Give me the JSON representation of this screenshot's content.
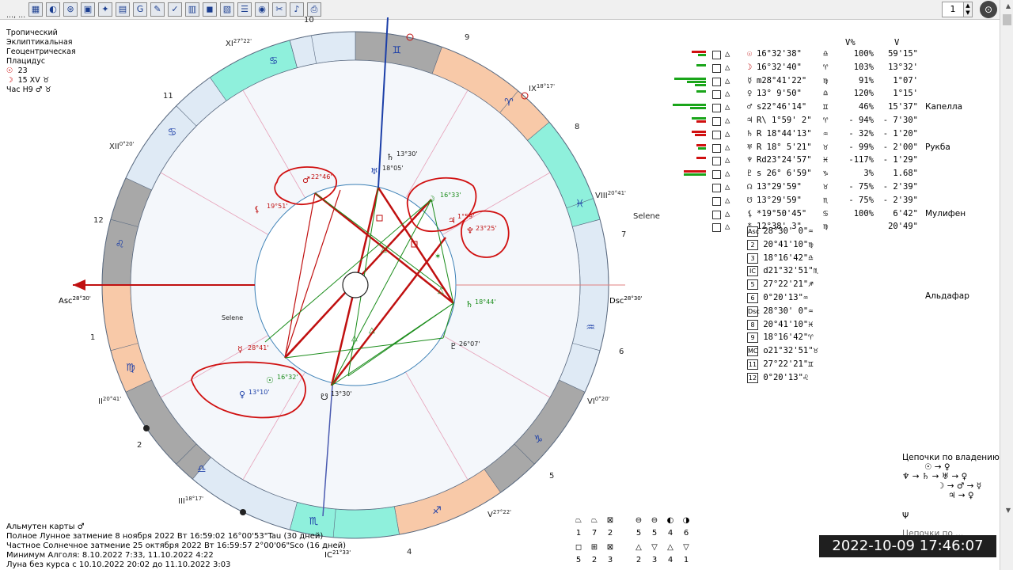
{
  "toolbar": {
    "icons": [
      "table-icon",
      "globe-icon",
      "wheel-icon",
      "map-icon",
      "transit-icon",
      "calendar-icon",
      "g-icon",
      "edit-icon",
      "check-icon",
      "grid-icon",
      "palette-icon",
      "aspect-icon",
      "list-icon",
      "blue-wheel-icon",
      "tools-icon",
      "bell-icon",
      "print-icon"
    ],
    "page_number": "1"
  },
  "header": {
    "clipped_line": "..., ...",
    "zodiac": "Тропический",
    "ecliptic": "Эклиптикальная",
    "centric": "Геоцентрическая",
    "house_system": "Плацидус",
    "sun_day": "23",
    "moon_day": "15 XV",
    "hour": "Час H9"
  },
  "wheel": {
    "asc_label": "Asc",
    "asc_deg": "28°30'",
    "dsc_label": "Dsc",
    "dsc_deg": "28°30'",
    "ic_label": "IC",
    "ic_deg": "21°33'",
    "cusps": [
      {
        "label": "XI",
        "deg": "27°22'"
      },
      {
        "label": "XII",
        "deg": "0°20'"
      },
      {
        "label": "II",
        "deg": "20°41'"
      },
      {
        "label": "III",
        "deg": "18°17'"
      },
      {
        "label": "IX",
        "deg": "18°17'"
      },
      {
        "label": "VIII",
        "deg": "20°41'"
      },
      {
        "label": "VI",
        "deg": "0°20'"
      },
      {
        "label": "V",
        "deg": "27°22'"
      }
    ],
    "house_numbers": [
      "10",
      "9",
      "11",
      "8",
      "12",
      "7",
      "1",
      "6",
      "2",
      "5",
      "4"
    ],
    "planet_labels": {
      "saturn_top": "13°30'",
      "mc_area": "18°05'",
      "p22": "22°46'",
      "lilith": "19°51'",
      "moon": "16°33'",
      "jupiter": "1°59'",
      "neptune": "23°25'",
      "saturn_r": "18°44'",
      "pluto": "26°07'",
      "mars": "28°41'",
      "sun": "16°32'",
      "venus": "13°10'",
      "node": "13°30'",
      "selene": "Selene",
      "selene_outer": "Selene"
    }
  },
  "planets": [
    {
      "sym": "☉",
      "pos": "16°32'38\"",
      "sign": "♎",
      "pct": "100%",
      "speed": "59'15\"",
      "star": "",
      "bars": [
        [
          18,
          "r"
        ],
        [
          10,
          "g"
        ]
      ]
    },
    {
      "sym": "☽",
      "pos": "16°32'40\"",
      "sign": "♈",
      "pct": "103%",
      "speed": "13°32'",
      "star": "",
      "bars": [
        [
          12,
          "g"
        ]
      ]
    },
    {
      "sym": "☿",
      "pos": "m28°41'22\"",
      "sign": "♍",
      "pct": "91%",
      "speed": "1°07'",
      "star": "",
      "bars": [
        [
          40,
          "g"
        ],
        [
          24,
          "g"
        ],
        [
          14,
          "g"
        ]
      ]
    },
    {
      "sym": "♀",
      "pos": "13° 9'50\"",
      "sign": "♎",
      "pct": "120%",
      "speed": "1°15'",
      "star": "",
      "bars": [
        [
          12,
          "g"
        ]
      ]
    },
    {
      "sym": "♂",
      "pos": "s22°46'14\"",
      "sign": "♊",
      "pct": "46%",
      "speed": "15'37\"",
      "star": "Капелла",
      "bars": [
        [
          42,
          "g"
        ],
        [
          20,
          "g"
        ]
      ]
    },
    {
      "sym": "♃",
      "pos": "R\\ 1°59' 2\"",
      "sign": "♈",
      "pct": "- 94%",
      "speed": "- 7'30\"",
      "star": "",
      "bars": [
        [
          18,
          "g"
        ],
        [
          12,
          "r"
        ]
      ]
    },
    {
      "sym": "♄",
      "pos": "R 18°44'13\"",
      "sign": "♒",
      "pct": "- 32%",
      "speed": "- 1'20\"",
      "star": "",
      "bars": [
        [
          18,
          "r"
        ],
        [
          14,
          "r"
        ]
      ]
    },
    {
      "sym": "♅",
      "pos": "R 18° 5'21\"",
      "sign": "♉",
      "pct": "- 99%",
      "speed": "- 2'00\"",
      "star": "Рукба",
      "bars": [
        [
          12,
          "r"
        ],
        [
          10,
          "g"
        ]
      ]
    },
    {
      "sym": "♆",
      "pos": "Rd23°24'57\"",
      "sign": "♓",
      "pct": "-117%",
      "speed": "- 1'29\"",
      "star": "",
      "bars": [
        [
          12,
          "r"
        ]
      ]
    },
    {
      "sym": "♇",
      "pos": "s 26° 6'59\"",
      "sign": "♑",
      "pct": "3%",
      "speed": "1.68\"",
      "star": "",
      "bars": [
        [
          28,
          "r"
        ],
        [
          28,
          "g"
        ]
      ]
    },
    {
      "sym": "☊",
      "pos": "13°29'59\"",
      "sign": "♉",
      "pct": "- 75%",
      "speed": "- 2'39\"",
      "star": "",
      "bars": []
    },
    {
      "sym": "☋",
      "pos": "13°29'59\"",
      "sign": "♏",
      "pct": "- 75%",
      "speed": "- 2'39\"",
      "star": "",
      "bars": []
    },
    {
      "sym": "⚸",
      "pos": "*19°50'45\"",
      "sign": "♋",
      "pct": "100%",
      "speed": "6'42\"",
      "star": "Мулифен",
      "bars": []
    },
    {
      "sym": "*",
      "pos": "12°38' 3\"",
      "sign": "♍",
      "pct": "",
      "speed": "20'49\"",
      "star": "",
      "bars": []
    }
  ],
  "cusps": [
    {
      "lbl": "Asc",
      "pos": "28°30' 0\"",
      "sign": "♒"
    },
    {
      "lbl": "2",
      "pos": "20°41'10\"",
      "sign": "♍"
    },
    {
      "lbl": "3",
      "pos": "18°16'42\"",
      "sign": "♎"
    },
    {
      "lbl": "IC",
      "pos": "d21°32'51\"",
      "sign": "♏"
    },
    {
      "lbl": "5",
      "pos": "27°22'21\"",
      "sign": "♐"
    },
    {
      "lbl": "6",
      "pos": "0°20'13\"",
      "sign": "♒"
    },
    {
      "lbl": "Dsc",
      "pos": "28°30' 0\"",
      "sign": "♒"
    },
    {
      "lbl": "8",
      "pos": "20°41'10\"",
      "sign": "♓"
    },
    {
      "lbl": "9",
      "pos": "18°16'42\"",
      "sign": "♈"
    },
    {
      "lbl": "MC",
      "pos": "o21°32'51\"",
      "sign": "♉"
    },
    {
      "lbl": "11",
      "pos": "27°22'21\"",
      "sign": "♊"
    },
    {
      "lbl": "12",
      "pos": "0°20'13\"",
      "sign": "♌"
    }
  ],
  "stars": {
    "aldafar": "Альдафар"
  },
  "chains": {
    "title": "Цепочки по владению",
    "rows": [
      "☉ → ♀",
      "♆ → ♄ → ♅ → ♀",
      "☽ → ♂ → ☿",
      "♃ → ♀"
    ],
    "tail": "Ψ",
    "clipped": "Цепочки по ...",
    "clipped_bottom": "♄ → ☉ → ♂ → ♀ → ♀"
  },
  "footer": {
    "almuten": "Альмутен карты ♂",
    "eclipse1": "Полное Лунное затмение 8 ноября 2022 Вт 16:59:02 16°00'53\"Tau (30 дней)",
    "eclipse2": "Частное Солнечное затмение 25 октября 2022 Вт 16:59:57 2°00'06\"Sco (16 дней)",
    "algol": "Минимум Алголя: 8.10.2022 7:33, 11.10.2022 4:22",
    "void": "Луна без курса с 10.10.2022 20:02 до 11.10.2022 3:03"
  },
  "mini_grid": {
    "row1_nums": [
      "1",
      "7",
      "2"
    ],
    "row2_nums": [
      "5",
      "2",
      "3"
    ],
    "row3_nums": [
      "5",
      "5",
      "4",
      "6"
    ],
    "row4_nums": [
      "2",
      "3",
      "4",
      "1"
    ]
  },
  "timestamp": "2022-10-09 17:46:07",
  "colors": {
    "red": "#d01010",
    "green": "#1aa51a",
    "grey": "#a8a8a8",
    "salmon": "#f8c9a8",
    "cyan": "#8ff0dc",
    "blueband": "#dfeaf5"
  }
}
